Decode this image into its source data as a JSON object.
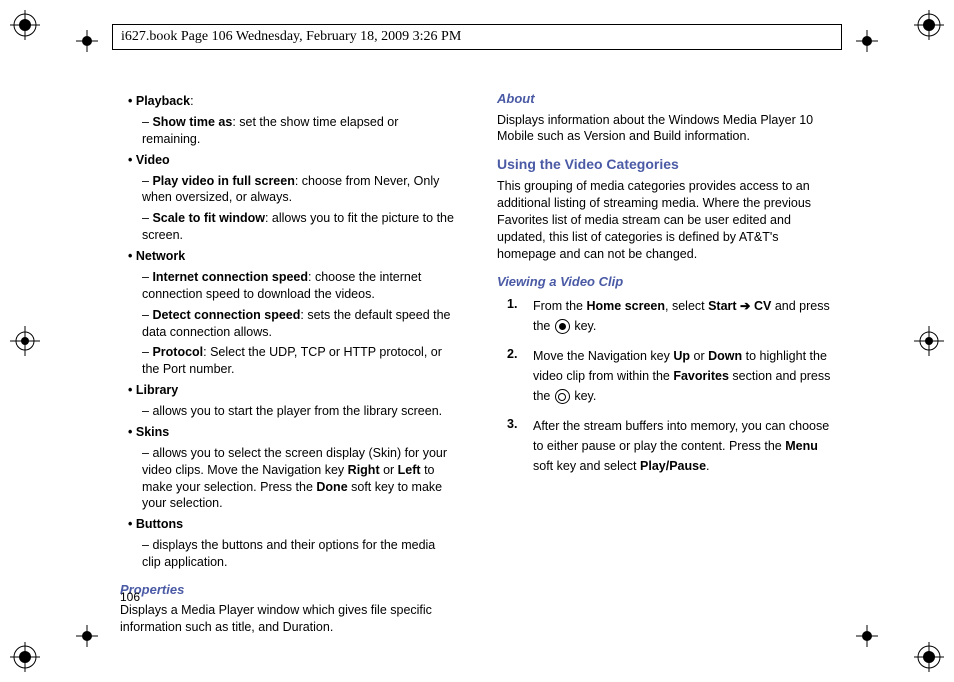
{
  "header": "i627.book  Page 106  Wednesday, February 18, 2009  3:26 PM",
  "page_number": "106",
  "left": {
    "playback_label": "Playback",
    "playback_colon": ":",
    "showtime_label": "Show time as",
    "showtime_desc": ": set the show time elapsed or remaining.",
    "video_label": "Video",
    "playfull_label": "Play video in full screen",
    "playfull_desc": ": choose from Never, Only when oversized, or always.",
    "scale_label": "Scale to fit window",
    "scale_desc": ": allows you to fit the picture to the screen.",
    "network_label": "Network",
    "inet_label": "Internet connection speed",
    "inet_desc": ": choose the internet connection speed to download the videos.",
    "detect_label": "Detect connection speed",
    "detect_desc": ": sets the default speed the data connection allows.",
    "protocol_label": "Protocol",
    "protocol_desc": ": Select the UDP, TCP or HTTP protocol, or the Port number.",
    "library_label": "Library",
    "library_desc": "allows you to start the player from the library screen.",
    "skins_label": "Skins",
    "skins_desc_1": "allows you to select the screen display (Skin) for your video clips. Move the Navigation key ",
    "skins_right": "Right",
    "skins_or": " or ",
    "skins_left": "Left",
    "skins_desc_2": " to make your selection. Press the ",
    "skins_done": "Done",
    "skins_desc_3": " soft key to make your selection.",
    "buttons_label": "Buttons",
    "buttons_desc": "displays the buttons and their options for the media clip application.",
    "properties_title": "Properties",
    "properties_body": "Displays a Media Player window which gives file specific information such as title, and Duration."
  },
  "right": {
    "about_title": "About",
    "about_body": "Displays information about the Windows Media Player 10 Mobile such as Version and Build information.",
    "using_title": "Using the Video Categories",
    "using_body": "This grouping of media categories provides access to an additional listing of streaming media. Where the previous Favorites list of media stream can be user edited and updated, this list of categories is defined by AT&T's homepage and can not be changed.",
    "viewing_title": "Viewing a Video Clip",
    "step1_a": "From the ",
    "step1_home": "Home screen",
    "step1_b": ", select ",
    "step1_start": "Start",
    "step1_arrow": " ➔ ",
    "step1_cv": "CV",
    "step1_c": " and press the ",
    "step1_d": " key.",
    "step2_a": "Move the Navigation key ",
    "step2_up": "Up",
    "step2_or": " or ",
    "step2_down": "Down",
    "step2_b": " to highlight the video clip from within the ",
    "step2_fav": "Favorites",
    "step2_c": " section and press the ",
    "step2_d": " key.",
    "step3_a": "After the stream buffers into memory, you can choose to either pause or play the content. Press the ",
    "step3_menu": "Menu",
    "step3_b": " soft key and select ",
    "step3_pp": "Play/Pause",
    "step3_c": "."
  }
}
